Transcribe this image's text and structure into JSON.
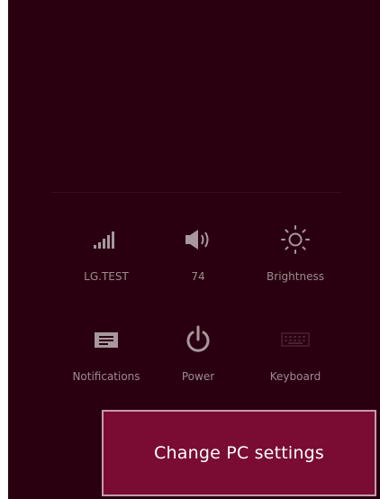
{
  "colors": {
    "panel_background": "#2a0010",
    "icon_color": "#a8979e",
    "label_color": "#9e8a92",
    "settings_button_background": "#7a0c33",
    "settings_button_border": "#c89aab"
  },
  "quick_settings": [
    {
      "id": "network",
      "icon": "signal-bars-icon",
      "label": "LG.TEST"
    },
    {
      "id": "volume",
      "icon": "speaker-icon",
      "label": "74"
    },
    {
      "id": "brightness",
      "icon": "sun-icon",
      "label": "Brightness"
    },
    {
      "id": "notifications",
      "icon": "message-icon",
      "label": "Notifications"
    },
    {
      "id": "power",
      "icon": "power-icon",
      "label": "Power"
    },
    {
      "id": "keyboard",
      "icon": "keyboard-icon",
      "label": "Keyboard"
    }
  ],
  "settings_button": {
    "label": "Change PC settings"
  }
}
